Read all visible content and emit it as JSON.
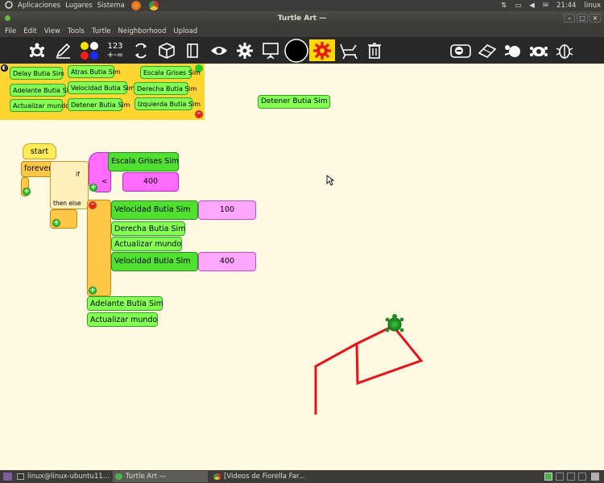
{
  "top_panel": {
    "menu_apps": "Aplicaciones",
    "menu_places": "Lugares",
    "menu_system": "Sistema",
    "clock": "21:44",
    "user": "linux"
  },
  "window": {
    "title": "Turtle Art —",
    "controls": [
      "–",
      "□",
      "×"
    ]
  },
  "menubar": [
    "File",
    "Edit",
    "View",
    "Tools",
    "Turtle",
    "Neighborhood",
    "Upload"
  ],
  "toolbar": {
    "number_label_top": "123",
    "number_label_bottom": "+-="
  },
  "palette": {
    "blocks": [
      "Delay Butia Sim",
      "Atras Butia Sim",
      "Escala Grises Sim",
      "Adelante Butia Sim",
      "Velocidad Butia Sim",
      "Derecha Butia Sim",
      "Actualizar mundo",
      "Detener Butia Sim",
      "Izquierda Butia Sim"
    ]
  },
  "floating_block": "Detener Butia Sim",
  "program": {
    "start": "start",
    "forever": "forever",
    "if": "if",
    "then_else": "then else",
    "sensor": "Escala Grises Sim",
    "operator": "<",
    "threshold": "400",
    "speed1_label": "Velocidad Butia Sim",
    "speed1_value": "100",
    "right": "Derecha Butia Sim",
    "update1": "Actualizar mundo",
    "speed2_label": "Velocidad Butia Sim",
    "speed2_value": "400",
    "forward": "Adelante Butia Sim",
    "update2": "Actualizar mundo"
  },
  "taskbar": [
    {
      "label": "linux@linux-ubuntu11...."
    },
    {
      "label": "Turtle Art —"
    },
    {
      "label": "[Videos de Fiorella Far..."
    }
  ],
  "colors": {
    "pen": "#e8121c",
    "turtle": "#1f8f24"
  }
}
